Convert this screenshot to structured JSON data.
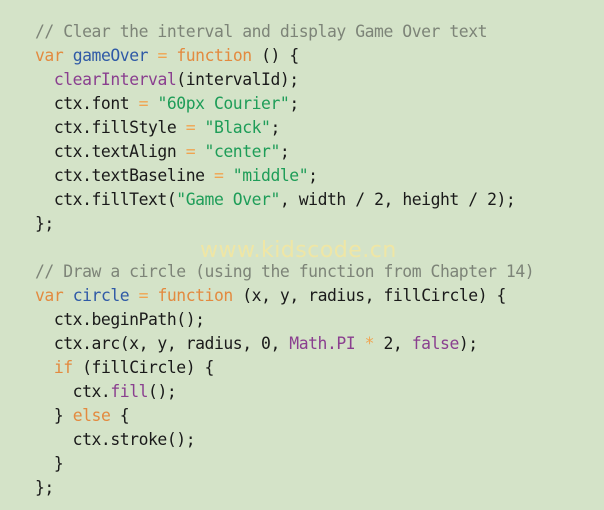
{
  "watermark": "www.kidscode.cn",
  "colors": {
    "background": "#d4e3c8",
    "comment": "#7d8478",
    "keyword": "#e38a3f",
    "identifier": "#2f5aa6",
    "string": "#1e9d58",
    "builtin": "#8a3f8f",
    "plain": "#1a1a1a"
  },
  "code_lines": [
    [
      {
        "t": "// Clear the interval and display Game Over text",
        "k": "comment"
      }
    ],
    [
      {
        "t": "var",
        "k": "keyword"
      },
      {
        "t": " ",
        "k": "plain"
      },
      {
        "t": "gameOver",
        "k": "ident"
      },
      {
        "t": " ",
        "k": "plain"
      },
      {
        "t": "=",
        "k": "op"
      },
      {
        "t": " ",
        "k": "plain"
      },
      {
        "t": "function",
        "k": "keyword"
      },
      {
        "t": " () {",
        "k": "plain"
      }
    ],
    [
      {
        "t": "  ",
        "k": "plain"
      },
      {
        "t": "clearInterval",
        "k": "builtin"
      },
      {
        "t": "(intervalId);",
        "k": "plain"
      }
    ],
    [
      {
        "t": "  ctx.font ",
        "k": "plain"
      },
      {
        "t": "=",
        "k": "op"
      },
      {
        "t": " ",
        "k": "plain"
      },
      {
        "t": "\"60px Courier\"",
        "k": "string"
      },
      {
        "t": ";",
        "k": "plain"
      }
    ],
    [
      {
        "t": "  ctx.fillStyle ",
        "k": "plain"
      },
      {
        "t": "=",
        "k": "op"
      },
      {
        "t": " ",
        "k": "plain"
      },
      {
        "t": "\"Black\"",
        "k": "string"
      },
      {
        "t": ";",
        "k": "plain"
      }
    ],
    [
      {
        "t": "  ctx.textAlign ",
        "k": "plain"
      },
      {
        "t": "=",
        "k": "op"
      },
      {
        "t": " ",
        "k": "plain"
      },
      {
        "t": "\"center\"",
        "k": "string"
      },
      {
        "t": ";",
        "k": "plain"
      }
    ],
    [
      {
        "t": "  ctx.textBaseline ",
        "k": "plain"
      },
      {
        "t": "=",
        "k": "op"
      },
      {
        "t": " ",
        "k": "plain"
      },
      {
        "t": "\"middle\"",
        "k": "string"
      },
      {
        "t": ";",
        "k": "plain"
      }
    ],
    [
      {
        "t": "  ctx.fillText(",
        "k": "plain"
      },
      {
        "t": "\"Game Over\"",
        "k": "string"
      },
      {
        "t": ", width / 2, height / 2);",
        "k": "plain"
      }
    ],
    [
      {
        "t": "};",
        "k": "plain"
      }
    ],
    [],
    [
      {
        "t": "// Draw a circle (using the function from Chapter 14)",
        "k": "comment"
      }
    ],
    [
      {
        "t": "var",
        "k": "keyword"
      },
      {
        "t": " ",
        "k": "plain"
      },
      {
        "t": "circle",
        "k": "ident"
      },
      {
        "t": " ",
        "k": "plain"
      },
      {
        "t": "=",
        "k": "op"
      },
      {
        "t": " ",
        "k": "plain"
      },
      {
        "t": "function",
        "k": "keyword"
      },
      {
        "t": " (x, y, radius, fillCircle) {",
        "k": "plain"
      }
    ],
    [
      {
        "t": "  ctx.beginPath();",
        "k": "plain"
      }
    ],
    [
      {
        "t": "  ctx.arc(x, y, radius, 0, ",
        "k": "plain"
      },
      {
        "t": "Math.PI",
        "k": "builtin"
      },
      {
        "t": " ",
        "k": "plain"
      },
      {
        "t": "*",
        "k": "op"
      },
      {
        "t": " 2, ",
        "k": "plain"
      },
      {
        "t": "false",
        "k": "builtin"
      },
      {
        "t": ");",
        "k": "plain"
      }
    ],
    [
      {
        "t": "  ",
        "k": "plain"
      },
      {
        "t": "if",
        "k": "keyword"
      },
      {
        "t": " (fillCircle) {",
        "k": "plain"
      }
    ],
    [
      {
        "t": "    ctx.",
        "k": "plain"
      },
      {
        "t": "fill",
        "k": "builtin"
      },
      {
        "t": "();",
        "k": "plain"
      }
    ],
    [
      {
        "t": "  } ",
        "k": "plain"
      },
      {
        "t": "else",
        "k": "keyword"
      },
      {
        "t": " {",
        "k": "plain"
      }
    ],
    [
      {
        "t": "    ctx.stroke();",
        "k": "plain"
      }
    ],
    [
      {
        "t": "  }",
        "k": "plain"
      }
    ],
    [
      {
        "t": "};",
        "k": "plain"
      }
    ]
  ]
}
